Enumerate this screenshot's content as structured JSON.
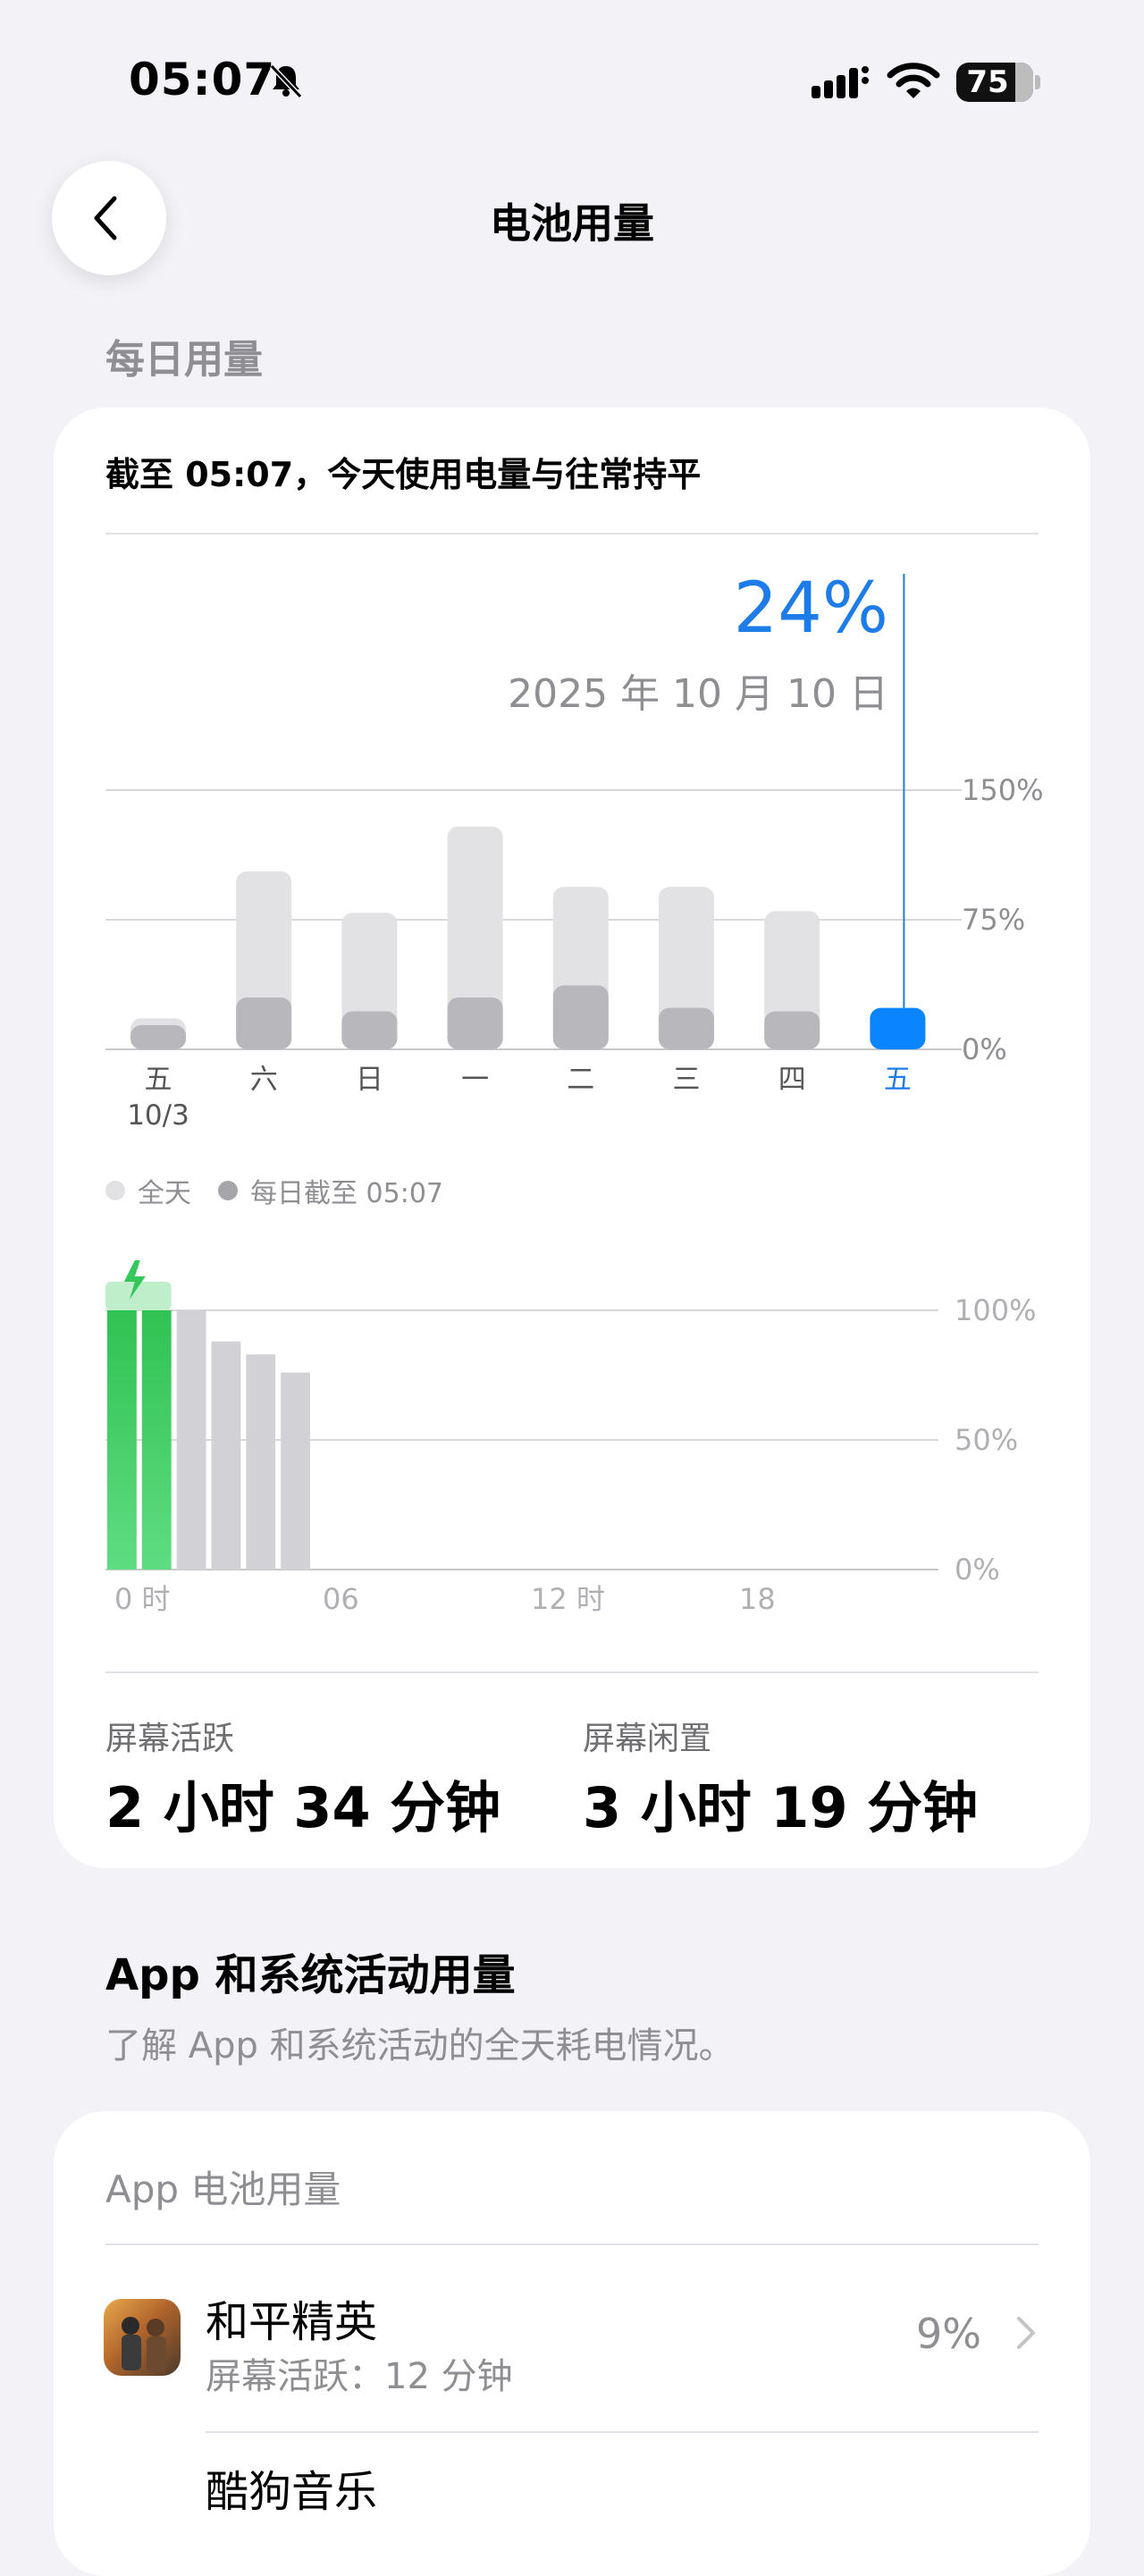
{
  "status": {
    "time": "05:07",
    "battery": "75"
  },
  "nav": {
    "title": "电池用量"
  },
  "daily": {
    "section_title": "每日用量",
    "summary": "截至 05:07，今天使用电量与往常持平",
    "selected_percent": "24%",
    "selected_date": "2025 年 10 月 10 日"
  },
  "chart_data": [
    {
      "type": "bar",
      "categories": [
        "五",
        "六",
        "日",
        "一",
        "二",
        "三",
        "四",
        "五"
      ],
      "sub_labels": [
        "10/3",
        "",
        "",
        "",
        "",
        "",
        "",
        ""
      ],
      "series": [
        {
          "name": "全天",
          "values": [
            18,
            103,
            79,
            129,
            94,
            94,
            80,
            24
          ]
        },
        {
          "name": "每日截至 05:07",
          "values": [
            14,
            30,
            22,
            30,
            37,
            24,
            22,
            24
          ]
        }
      ],
      "y_ticks": [
        "0%",
        "75%",
        "150%"
      ],
      "ylim": [
        0,
        150
      ],
      "selected_index": 7,
      "colors": {
        "all_day": "#e2e2e4",
        "to_time": "#b8b8bc",
        "selected": "#0a84ff"
      }
    },
    {
      "type": "bar",
      "x_ticks": [
        "0 时",
        "06",
        "12 时",
        "18"
      ],
      "y_ticks": [
        "0%",
        "50%",
        "100%"
      ],
      "ylim": [
        0,
        100
      ],
      "hours": [
        0,
        1,
        2,
        3,
        4,
        5
      ],
      "values": [
        100,
        100,
        100,
        88,
        83,
        76
      ],
      "charging": [
        true,
        true,
        false,
        false,
        false,
        false
      ],
      "colors": {
        "charging": "#34c759",
        "discharging": "#d1d1d6"
      }
    }
  ],
  "legend": {
    "all_day": "全天",
    "to_time": "每日截至 05:07"
  },
  "stats": {
    "active_label": "屏幕活跃",
    "active_value": "2 小时 34 分钟",
    "idle_label": "屏幕闲置",
    "idle_value": "3 小时 19 分钟"
  },
  "activity": {
    "title": "App 和系统活动用量",
    "description": "了解 App 和系统活动的全天耗电情况。"
  },
  "apps": {
    "header": "App 电池用量",
    "items": [
      {
        "name": "和平精英",
        "sub": "屏幕活跃：12 分钟",
        "pct": "9%"
      },
      {
        "name": "酷狗音乐",
        "sub": "",
        "pct": ""
      }
    ]
  }
}
